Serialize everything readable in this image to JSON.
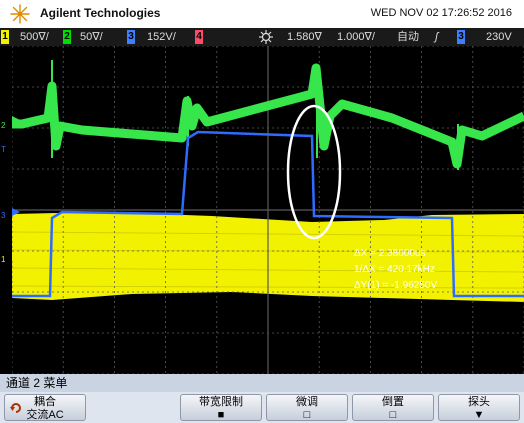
{
  "header": {
    "brand": "Agilent Technologies",
    "datetime": "WED NOV 02 17:26:52 2016"
  },
  "status_bar": {
    "ch1": {
      "num": "1",
      "scale": "500∇/",
      "color": "#f2f200"
    },
    "ch2": {
      "num": "2",
      "scale": "50∇/",
      "color": "#00e000"
    },
    "ch3": {
      "num": "3",
      "scale": "152V/",
      "color": "#3f7fff"
    },
    "ch4": {
      "num": "4",
      "color": "#ff4a6a"
    },
    "timebase_pos": "1.580∇",
    "timebase_scale": "1.000∇/",
    "trigger_mode": "自动",
    "trigger_slope": "ʃ",
    "trigger_source": "3",
    "trigger_level": "230V"
  },
  "measurements": {
    "delta_x": "ΔX = 2.38000us",
    "inv_delta_x": "1/ΔX = 420.17kHz",
    "delta_y": "ΔY(1) = -1.96250V"
  },
  "menu": {
    "title": "通道 2 菜单"
  },
  "softkeys": {
    "coupling_label": "耦合",
    "coupling_value": "交流AC",
    "bw_limit_label": "带宽限制",
    "fine_label": "微调",
    "invert_label": "倒置",
    "probe_label": "探头"
  },
  "colors": {
    "ch1": "#f2f200",
    "ch2": "#36e64a",
    "ch3": "#2f6bff",
    "highlight": "#ffffff"
  }
}
